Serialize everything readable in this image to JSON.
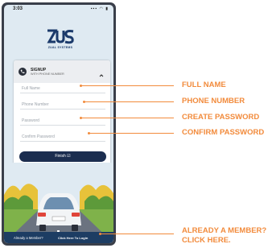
{
  "status_bar": {
    "time": "3:03",
    "icons": "▪▪▪ ◠ ▮"
  },
  "logo": {
    "text": "ZUAL SYSTEMS"
  },
  "signup": {
    "title": "SIGNUP",
    "subtitle": "WITH PHONE NUMBER",
    "fields": [
      {
        "placeholder": "Full Name"
      },
      {
        "placeholder": "Phone Number"
      },
      {
        "placeholder": "Password"
      },
      {
        "placeholder": "Confirm Password"
      }
    ],
    "finish_label": "Finish ☑"
  },
  "bottom_bar": {
    "prompt": "Already a Member?",
    "link": "Click Here To Login"
  },
  "annotations": {
    "full_name": "FULL NAME",
    "phone_number": "PHONE NUMBER",
    "create_password": "CREATE PASSWORD",
    "confirm_password": "CONFIRM PASSWORD",
    "login_line1": "ALREADY A MEMBER?",
    "login_line2": "CLICK HERE."
  },
  "colors": {
    "accent": "#f28b3c",
    "brand": "#1b2d4f",
    "bar": "#1d3d63"
  }
}
